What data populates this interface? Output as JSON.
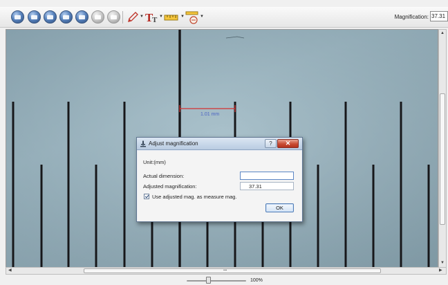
{
  "toolbar": {
    "buttons": [
      {
        "icon": "capture-icon",
        "enabled": true
      },
      {
        "icon": "open-icon",
        "enabled": true
      },
      {
        "icon": "save-icon",
        "enabled": true
      },
      {
        "icon": "zoom-in-icon",
        "enabled": true
      },
      {
        "icon": "zoom-out-icon",
        "enabled": true
      },
      {
        "icon": "undo-icon",
        "enabled": false
      },
      {
        "icon": "redo-icon",
        "enabled": false
      }
    ],
    "tools": [
      "pencil-icon",
      "text-tool-icon",
      "ruler-icon",
      "measure-angle-icon"
    ],
    "magnification_label": "Magnification:",
    "magnification_value": "37.31"
  },
  "viewport": {
    "measurement_label": "1.01 mm",
    "ruler_line_color": "#17171a",
    "measure_color": "#d43030",
    "label_color": "#4a63c4"
  },
  "dialog": {
    "title": "Adjust magnification",
    "help_label": "?",
    "close_label": "✕",
    "unit_label": "Unit:(mm)",
    "actual_dimension_label": "Actual dimension:",
    "actual_dimension_value": "",
    "adjusted_mag_label": "Adjusted magnification:",
    "adjusted_mag_value": "37.31",
    "checkbox_label": "Use adjusted mag. as measure mag.",
    "checkbox_checked": true,
    "ok_label": "OK"
  },
  "zoom": {
    "percent": "100%",
    "slider_fraction": 0.35
  }
}
